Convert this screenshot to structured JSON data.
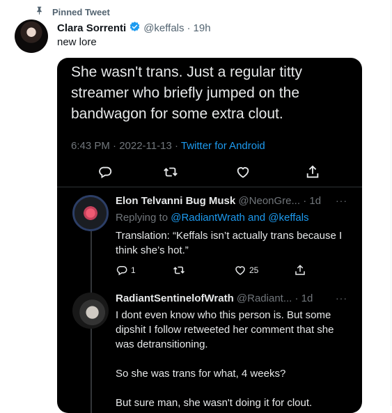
{
  "pinned": {
    "label": "Pinned Tweet"
  },
  "tweet": {
    "name": "Clara Sorrenti",
    "handle": "@keffals",
    "dot": "·",
    "time": "19h",
    "text": "new lore"
  },
  "screenshot": {
    "text": "She wasn't trans.  Just a regular titty streamer who briefly jumped on the bandwagon for some extra clout.",
    "timestamp": "6:43 PM · 2022-11-13 · ",
    "source": "Twitter for Android",
    "reply1": {
      "name": "Elon Telvanni Bug Musk",
      "handle": "@NeonGre...",
      "time": "· 1d",
      "replying_prefix": "Replying to ",
      "mentions": "@RadiantWrath and @keffals",
      "text": "Translation: “Keffals isn’t actually trans because I think she’s hot.”",
      "reply_count": "1",
      "like_count": "25"
    },
    "reply2": {
      "name": "RadiantSentinelofWrath",
      "handle": "@Radiant...",
      "time": "· 1d",
      "text_line1": "I dont even know who this person is.  But some dipshit I follow retweeted her comment that she was detransitioning.",
      "text_line2": "So she was trans for what, 4 weeks?",
      "text_line3": "But sure man, she wasn't doing it for clout."
    },
    "more": "···"
  },
  "colors": {
    "accent": "#1d9bf0",
    "dark_bg": "#000000",
    "muted": "#71767b"
  }
}
